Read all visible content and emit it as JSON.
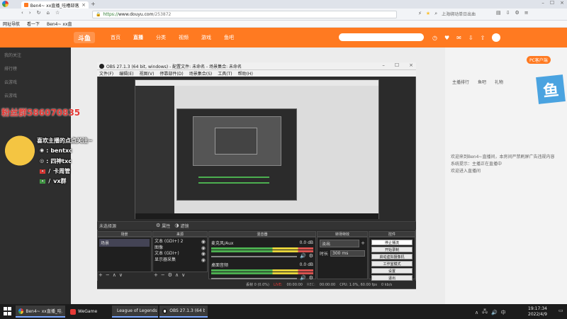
{
  "browser": {
    "tab_title": "Ben4~ xx直播_哇槽部落直播",
    "url": "https://www.douyu.com/253872",
    "url_scheme": "https://",
    "url_domain": "www.douyu.com",
    "url_path": "/253872",
    "search_hint": "上海绑动单日出血",
    "bookmarks": [
      "网址导航",
      "看一下",
      "Ben4~ xx直"
    ]
  },
  "site": {
    "logo": "斗鱼",
    "nav": [
      "首页",
      "直播",
      "分类",
      "视频",
      "游戏",
      "鱼吧"
    ],
    "nav_active_index": 1,
    "left_menu": [
      "我的关注",
      "排行榜",
      "云游戏",
      "云游戏"
    ],
    "right_tabs": [
      "主播排行",
      "鱼吧",
      "礼物"
    ],
    "right_chat": [
      "欢迎来到Ben4~直播间，本房间严禁刷屏广告违规内容",
      "系统提示：主播正在直播中",
      "欢迎进入直播间"
    ],
    "pc_badge": "PC客户端",
    "brand": "鱼"
  },
  "overlay": {
    "group_text": "粉丝群586070835",
    "follow_line": "喜欢主播的点点关注~",
    "user1_name": "bentxc",
    "user2_name": "四神txc",
    "role1": "卡周管",
    "role2": "vx群"
  },
  "obs": {
    "title": "OBS 27.1.3 (64 bit, windows) - 配置文件: 未命名 - 场景集合: 未命名",
    "menu": [
      "文件(F)",
      "编辑(E)",
      "视图(V)",
      "停靠部件(D)",
      "场景集合(S)",
      "工具(T)",
      "帮助(H)"
    ],
    "no_source": "未选择源",
    "properties_btn": "属性",
    "filters_btn": "滤镜",
    "docks": {
      "scenes": "场景",
      "sources": "来源",
      "mixer": "混音器",
      "transitions": "转场特效",
      "controls": "控件"
    },
    "scene_items": [
      "场景"
    ],
    "source_items": [
      "文本 (GDI+) 2",
      "图像",
      "文本 (GDI+)",
      "显示器采集"
    ],
    "mixer": [
      {
        "name": "麦克风/Aux",
        "db": "0.0 dB"
      },
      {
        "name": "桌面音频",
        "db": "0.0 dB"
      }
    ],
    "transition": {
      "type": "淡出",
      "duration_label": "时长",
      "duration": "300 ms"
    },
    "controls": [
      "停止播流",
      "开始录制",
      "启动虚拟摄像机",
      "工作室模式",
      "设置",
      "退出"
    ],
    "status": {
      "dropped": "丢帧 0 (0.0%)",
      "live_label": "LIVE:",
      "live_time": "00:00:00",
      "rec_label": "REC:",
      "rec_time": "00:00:00",
      "cpu": "CPU: 1.0%, 60.00 fps",
      "kbps": "0 kb/s"
    }
  },
  "taskbar": {
    "items": [
      {
        "label": "Ben4~ xx直播_哇...",
        "icon": "browser-icon"
      },
      {
        "label": "WeGame",
        "icon": "wegame-icon"
      },
      {
        "label": "League of Legends",
        "icon": "lol-icon"
      },
      {
        "label": "OBS 27.1.3 (64 bit...",
        "icon": "obs-icon"
      }
    ],
    "time": "19:17:34",
    "date": "2022/4/9"
  },
  "colors": {
    "douyu_orange": "#ff7a21",
    "obs_dark": "#2b2b2b",
    "overlay_red": "#e53935"
  }
}
